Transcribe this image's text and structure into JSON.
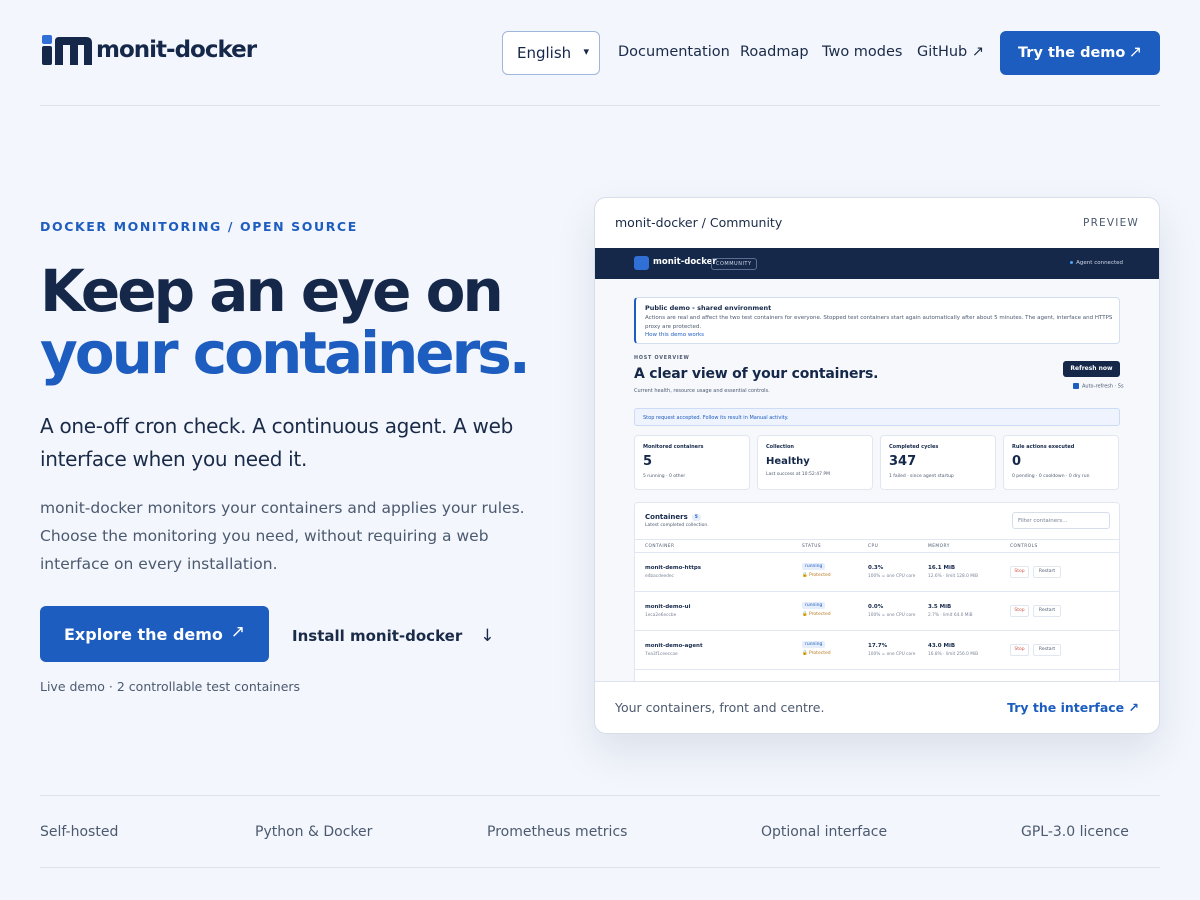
{
  "header": {
    "logo_text": "monit-docker",
    "language": "English",
    "nav": [
      "Documentation",
      "Roadmap",
      "Two modes",
      "GitHub ↗"
    ],
    "cta_label": "Try the demo",
    "cta_arrow": "↗"
  },
  "hero": {
    "eyebrow": "DOCKER MONITORING / OPEN SOURCE",
    "title_line1": "Keep an eye on",
    "title_line2": "your containers.",
    "lead": "A one-off cron check. A continuous agent. A web interface when you need it.",
    "body": "monit-docker monitors your containers and applies your rules. Choose the monitoring you need, without requiring a web interface on every installation.",
    "primary_label": "Explore the demo",
    "primary_arrow": "↗",
    "secondary_label": "Install monit-docker",
    "secondary_arrow": "↓",
    "note": "Live demo · 2 controllable test containers"
  },
  "preview": {
    "title": "monit-docker / Community",
    "tag": "PREVIEW",
    "caption": "Your containers, front and centre.",
    "link": "Try the interface ↗",
    "app": {
      "name": "monit-docker",
      "badge": "COMMUNITY",
      "agent_status": "Agent connected",
      "notice_title": "Public demo - shared environment",
      "notice_text": "Actions are real and affect the two test containers for everyone. Stopped test containers start again automatically after about 5 minutes. The agent, interface and HTTPS proxy are protected.",
      "notice_link": "How this demo works",
      "eyebrow": "HOST OVERVIEW",
      "heading": "A clear view of your containers.",
      "subheading": "Current health, resource usage and essential controls.",
      "refresh_label": "Refresh now",
      "auto_refresh": "Auto-refresh · 5s",
      "banner": "Stop request accepted. Follow its result in Manual activity.",
      "stats": [
        {
          "label": "Monitored containers",
          "value": "5",
          "foot": "5 running · 0 other"
        },
        {
          "label": "Collection",
          "value": "Healthy",
          "foot": "Last success at 10:52:47 PM"
        },
        {
          "label": "Completed cycles",
          "value": "347",
          "foot": "1 failed · since agent startup"
        },
        {
          "label": "Rule actions executed",
          "value": "0",
          "foot": "0 pending · 0 cooldown · 0 dry run"
        }
      ],
      "table": {
        "title": "Containers",
        "count": "5",
        "subtitle": "Latest completed collection.",
        "filter_placeholder": "Filter containers...",
        "headers": [
          "CONTAINER",
          "STATUS",
          "CPU",
          "MEMORY",
          "CONTROLS"
        ],
        "rows": [
          {
            "name": "monit-demo-https",
            "id": "e4bacdeedec",
            "status": "running",
            "protected": "Protected",
            "cpu": "0.3%",
            "cpu_sub": "100% = one CPU core",
            "mem": "16.1 MiB",
            "mem_sub": "12.6% · limit 128.0 MiB",
            "stop": "Stop",
            "restart": "Restart"
          },
          {
            "name": "monit-demo-ui",
            "id": "1eca2e6eccbe",
            "status": "running",
            "protected": "Protected",
            "cpu": "0.0%",
            "cpu_sub": "100% = one CPU core",
            "mem": "3.5 MiB",
            "mem_sub": "2.7% · limit 64.0 MiB",
            "stop": "Stop",
            "restart": "Restart"
          },
          {
            "name": "monit-demo-agent",
            "id": "7ea3f1ceeccae",
            "status": "running",
            "protected": "Protected",
            "cpu": "17.7%",
            "cpu_sub": "100% = one CPU core",
            "mem": "43.0 MiB",
            "mem_sub": "16.8% · limit 256.0 MiB",
            "stop": "Stop",
            "restart": "Restart"
          }
        ]
      }
    }
  },
  "features": [
    "Self-hosted",
    "Python & Docker",
    "Prometheus metrics",
    "Optional interface",
    "GPL-3.0 licence"
  ],
  "colors": {
    "accent": "#1d5dbf",
    "ink": "#15284a",
    "background": "#f3f6fc"
  }
}
